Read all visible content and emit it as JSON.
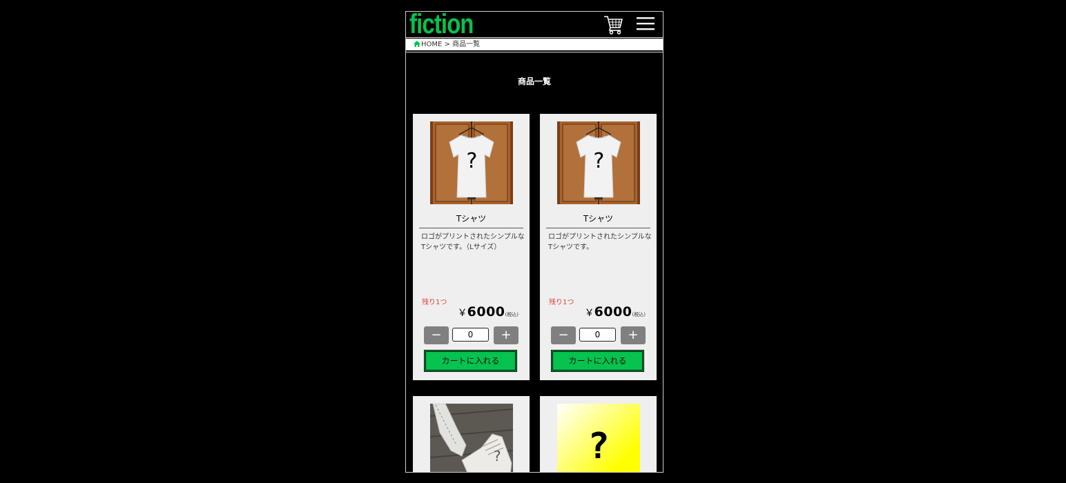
{
  "header": {
    "logo": "fiction"
  },
  "breadcrumb": {
    "home": "HOME",
    "separator": ">",
    "current": "商品一覧"
  },
  "page_title": "商品一覧",
  "accent_color": "#06c24f",
  "products": [
    {
      "name": "Tシャツ",
      "description": "ロゴがプリントされたシンプルなTシャツです。（Lサイズ）",
      "stock": "残り1つ",
      "yen": "￥",
      "price": "6000",
      "tax": "(税込)",
      "qty_minus": "−",
      "qty_plus": "+",
      "qty_value": "0",
      "cart_label": "カートに入れる",
      "image_question": "?",
      "image_icon": "tshirt-image"
    },
    {
      "name": "Tシャツ",
      "description": "ロゴがプリントされたシンプルなTシャツです。",
      "stock": "残り1つ",
      "yen": "￥",
      "price": "6000",
      "tax": "(税込)",
      "qty_minus": "−",
      "qty_plus": "+",
      "qty_value": "0",
      "cart_label": "カートに入れる",
      "image_question": "?",
      "image_icon": "tshirt-image"
    },
    {
      "image_question": "?",
      "image_icon": "sneakers-image"
    },
    {
      "image_question": "?",
      "image_icon": "yellow-gradient-image"
    }
  ]
}
